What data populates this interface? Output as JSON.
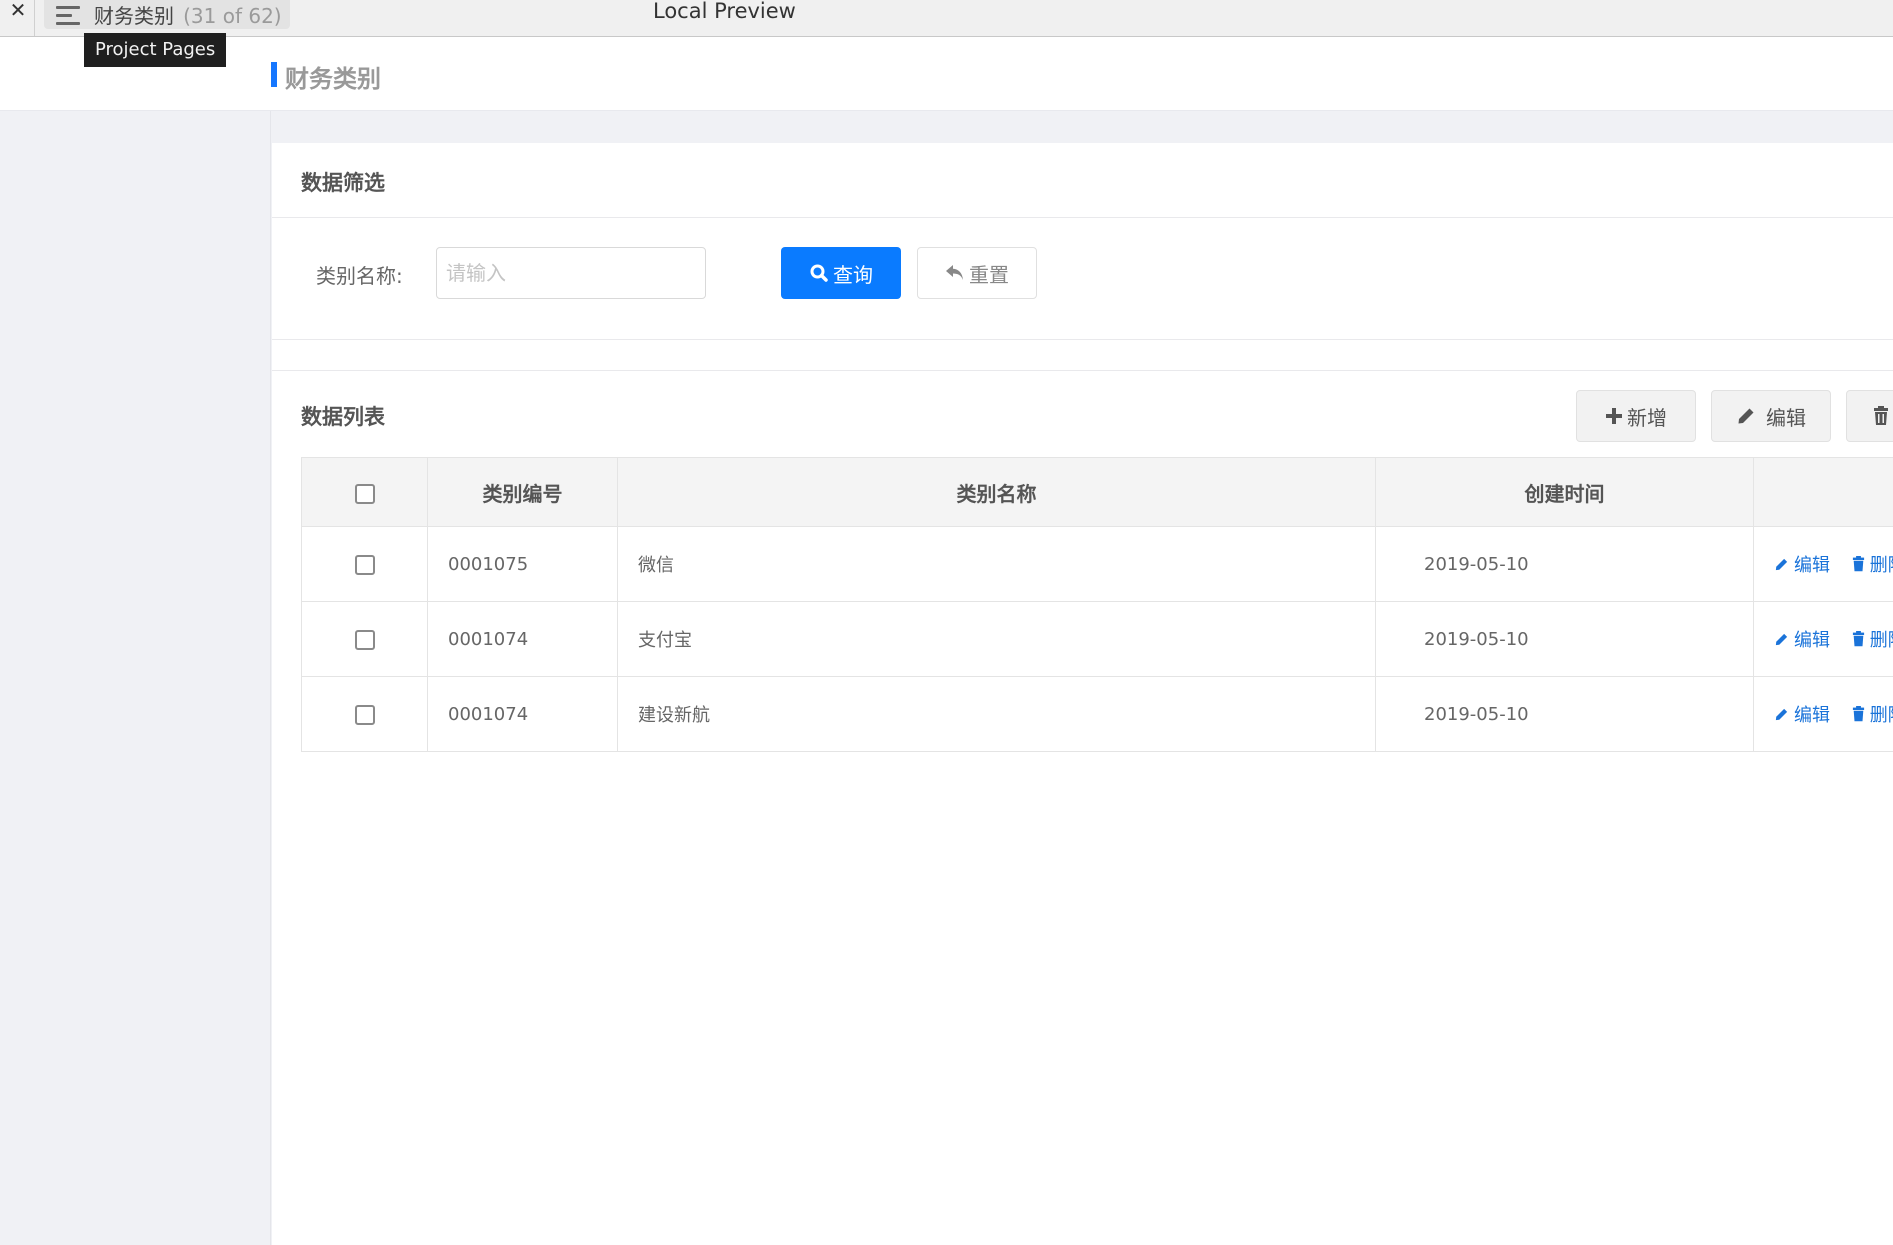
{
  "window": {
    "title": "Local Preview",
    "current_page": "财务类别",
    "page_count": "(31 of 62)",
    "tooltip": "Project Pages"
  },
  "header": {
    "title": "财务类别"
  },
  "filter": {
    "section_title": "数据筛选",
    "label": "类别名称:",
    "placeholder": "请输入",
    "value": "",
    "query_label": "查询",
    "reset_label": "重置"
  },
  "list": {
    "section_title": "数据列表",
    "toolbar": {
      "add_label": "新增",
      "edit_label": "编辑"
    },
    "columns": [
      "类别编号",
      "类别名称",
      "创建时间",
      ""
    ],
    "rows": [
      {
        "id": "0001075",
        "name": "微信",
        "created": "2019-05-10",
        "edit": "编辑",
        "delete": "删除"
      },
      {
        "id": "0001074",
        "name": "支付宝",
        "created": "2019-05-10",
        "edit": "编辑",
        "delete": "删除"
      },
      {
        "id": "0001074",
        "name": "建设新航",
        "created": "2019-05-10",
        "edit": "编辑",
        "delete": "删除"
      }
    ]
  },
  "colors": {
    "primary": "#0a7bff",
    "link": "#1a73d9",
    "accent_bar": "#1677ff"
  }
}
